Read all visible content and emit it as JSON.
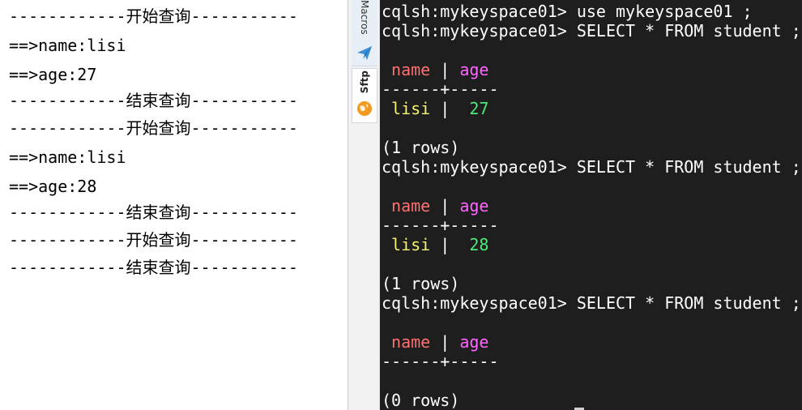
{
  "left_console": {
    "lines": [
      "------------开始查询-----------",
      "==>name:lisi",
      "==>age:27",
      "------------结束查询-----------",
      "------------开始查询-----------",
      "==>name:lisi",
      "==>age:28",
      "------------结束查询-----------",
      "------------开始查询-----------",
      "------------结束查询-----------"
    ]
  },
  "side_tabs": {
    "macros_label": "Macros",
    "sftp_label": "Sftp"
  },
  "terminal": {
    "prompt": "cqlsh:mykeyspace01>",
    "cmd_use": " use mykeyspace01 ;",
    "cmd_select": " SELECT * FROM student ;",
    "col_name": " name",
    "col_sep": " | ",
    "col_age": "age",
    "divider": "------+-----",
    "row1_name": " lisi",
    "row1_sep": " |  ",
    "row1_age": "27",
    "row2_name": " lisi",
    "row2_sep": " |  ",
    "row2_age": "28",
    "rows_one_a": "(1 rows)",
    "rows_one_b": "(1 rows)",
    "rows_zero": "(0 rows)"
  },
  "colors": {
    "terminal_bg": "#1e1e1e",
    "column_name": "#ff6f6f",
    "column_age": "#ff66ff",
    "value_text": "#f5f06e",
    "value_number": "#4ee87a"
  },
  "icons": {
    "macros": "paper-plane-icon",
    "sftp": "globe-icon"
  }
}
